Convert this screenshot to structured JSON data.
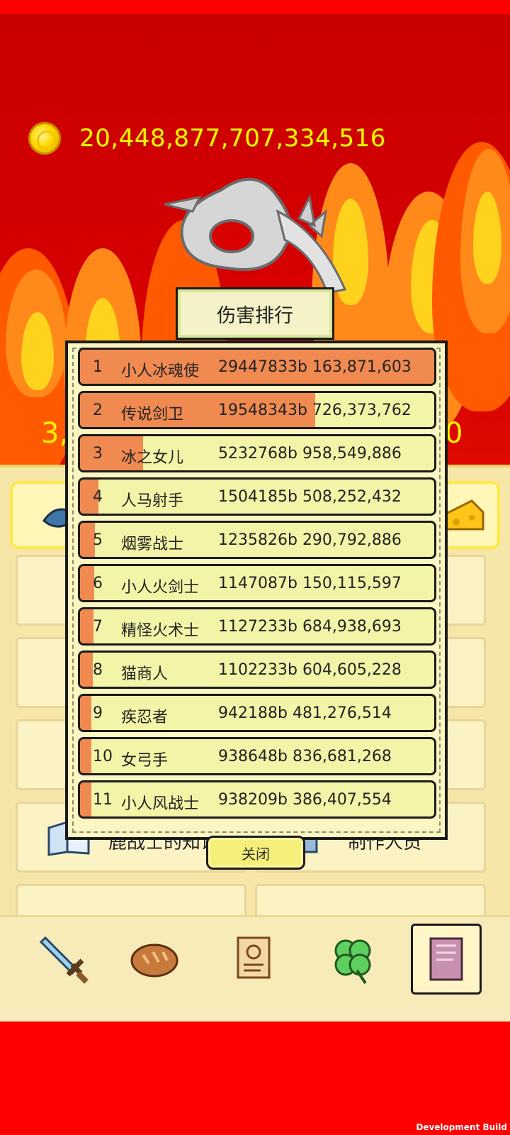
{
  "currency": {
    "coin_amount": "20,448,877,707,334,516",
    "icon": "gold-coin-icon"
  },
  "boss": {
    "counter_start": "3,",
    "counter_end": "0"
  },
  "menu": {
    "cards": [
      {
        "label": "鹿战士的知识",
        "icon": "book-icon"
      },
      {
        "label": "制作人员",
        "icon": "mug-icon"
      }
    ]
  },
  "ranking": {
    "title": "伤害排行",
    "close_label": "关闭",
    "rows": [
      {
        "rank": "1",
        "name": "小人冰魂使",
        "score": "29447833b 163,871,603",
        "share": 1.0
      },
      {
        "rank": "2",
        "name": "传说剑卫",
        "score": "19548343b 726,373,762",
        "share": 0.664
      },
      {
        "rank": "3",
        "name": "冰之女儿",
        "score": "5232768b 958,549,886",
        "share": 0.178
      },
      {
        "rank": "4",
        "name": "人马射手",
        "score": "1504185b 508,252,432",
        "share": 0.051
      },
      {
        "rank": "5",
        "name": "烟雾战士",
        "score": "1235826b 290,792,886",
        "share": 0.042
      },
      {
        "rank": "6",
        "name": "小人火剑士",
        "score": "1147087b 150,115,597",
        "share": 0.039
      },
      {
        "rank": "7",
        "name": "精怪火术士",
        "score": "1127233b 684,938,693",
        "share": 0.038
      },
      {
        "rank": "8",
        "name": "猫商人",
        "score": "1102233b 604,605,228",
        "share": 0.037
      },
      {
        "rank": "9",
        "name": "疾忍者",
        "score": "942188b 481,276,514",
        "share": 0.032
      },
      {
        "rank": "10",
        "name": "女弓手",
        "score": "938648b 836,681,268",
        "share": 0.032
      },
      {
        "rank": "11",
        "name": "小人风战士",
        "score": "938209b 386,407,554",
        "share": 0.032
      }
    ]
  },
  "bottom_nav": [
    {
      "icon": "sword-icon",
      "active": false
    },
    {
      "icon": "bread-icon",
      "active": false
    },
    {
      "icon": "scroll-icon",
      "active": false
    },
    {
      "icon": "clover-icon",
      "active": false
    },
    {
      "icon": "book-icon",
      "active": true
    }
  ],
  "footer": {
    "build_label": "Development Build"
  },
  "colors": {
    "bar_fill": "#f08a50",
    "row_bg": "#f4f4a8",
    "coin_text": "#fff200"
  }
}
